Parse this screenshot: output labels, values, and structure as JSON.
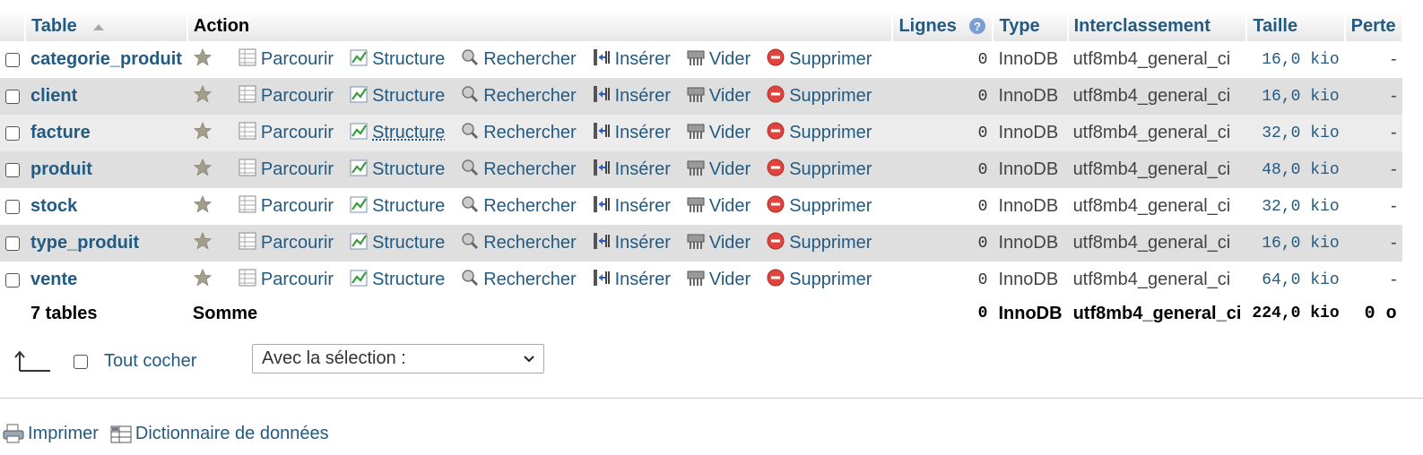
{
  "header": {
    "table": "Table",
    "action": "Action",
    "lignes": "Lignes",
    "type": "Type",
    "interclassement": "Interclassement",
    "taille": "Taille",
    "perte": "Perte"
  },
  "actions": {
    "browse": "Parcourir",
    "structure": "Structure",
    "search": "Rechercher",
    "insert": "Insérer",
    "empty": "Vider",
    "drop": "Supprimer"
  },
  "rows": [
    {
      "name": "categorie_produit",
      "rows": "0",
      "type": "InnoDB",
      "collation": "utf8mb4_general_ci",
      "size": "16,0 kio",
      "overhead": "-"
    },
    {
      "name": "client",
      "rows": "0",
      "type": "InnoDB",
      "collation": "utf8mb4_general_ci",
      "size": "16,0 kio",
      "overhead": "-"
    },
    {
      "name": "facture",
      "rows": "0",
      "type": "InnoDB",
      "collation": "utf8mb4_general_ci",
      "size": "32,0 kio",
      "overhead": "-"
    },
    {
      "name": "produit",
      "rows": "0",
      "type": "InnoDB",
      "collation": "utf8mb4_general_ci",
      "size": "48,0 kio",
      "overhead": "-"
    },
    {
      "name": "stock",
      "rows": "0",
      "type": "InnoDB",
      "collation": "utf8mb4_general_ci",
      "size": "32,0 kio",
      "overhead": "-"
    },
    {
      "name": "type_produit",
      "rows": "0",
      "type": "InnoDB",
      "collation": "utf8mb4_general_ci",
      "size": "16,0 kio",
      "overhead": "-"
    },
    {
      "name": "vente",
      "rows": "0",
      "type": "InnoDB",
      "collation": "utf8mb4_general_ci",
      "size": "64,0 kio",
      "overhead": "-"
    }
  ],
  "total": {
    "label": "7 tables",
    "sum": "Somme",
    "rows": "0",
    "type": "InnoDB",
    "collation": "utf8mb4_general_ci",
    "size": "224,0 kio",
    "overhead": "0 o"
  },
  "bulk": {
    "check_all": "Tout cocher",
    "with_selected": "Avec la sélection :"
  },
  "footer": {
    "print": "Imprimer",
    "dictionary": "Dictionnaire de données"
  },
  "colors": {
    "link": "#235a81",
    "row_alt": "#dfdfdf",
    "drop_red": "#e0443e"
  }
}
